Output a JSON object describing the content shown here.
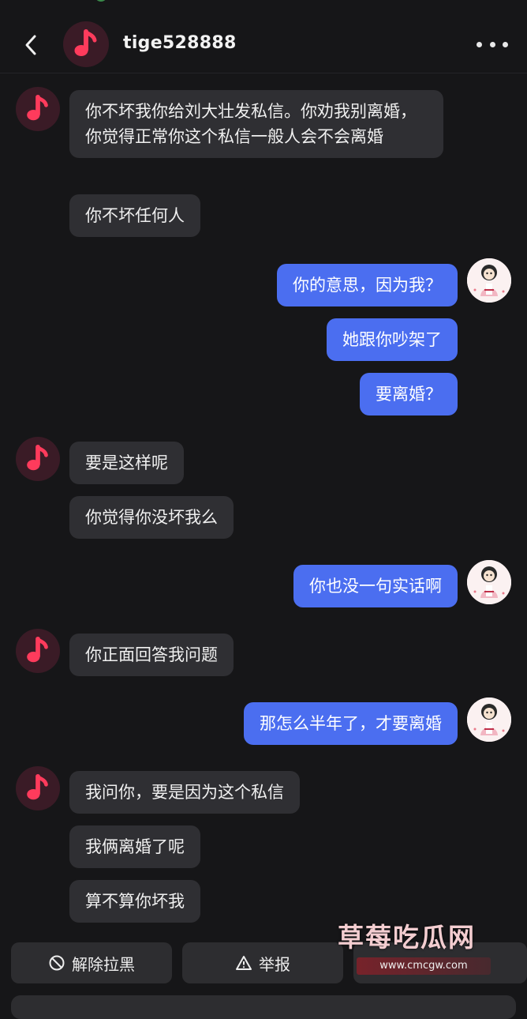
{
  "header": {
    "username": "tige528888"
  },
  "messages": [
    {
      "from": "other",
      "text": "你不坏我你给刘大壮发私信。你劝我别离婚，你觉得正常你这个私信一般人会不会离婚"
    },
    {
      "from": "other",
      "text": "你不坏任何人"
    },
    {
      "from": "me",
      "text": "你的意思，因为我？"
    },
    {
      "from": "me",
      "text": "她跟你吵架了"
    },
    {
      "from": "me",
      "text": "要离婚？"
    },
    {
      "from": "other",
      "text": "要是这样呢"
    },
    {
      "from": "other",
      "text": "你觉得你没坏我么"
    },
    {
      "from": "me",
      "text": "你也没一句实话啊"
    },
    {
      "from": "other",
      "text": "你正面回答我问题"
    },
    {
      "from": "me",
      "text": "那怎么半年了，才要离婚"
    },
    {
      "from": "other",
      "text": "我问你，要是因为这个私信"
    },
    {
      "from": "other",
      "text": "我俩离婚了呢"
    },
    {
      "from": "other",
      "text": "算不算你坏我"
    }
  ],
  "actions": {
    "unblock_label": "解除拉黑",
    "report_label": "举报"
  },
  "watermark": {
    "title": "草莓吃瓜网",
    "url": "www.cmcgw.com"
  },
  "colors": {
    "background": "#161618",
    "incoming_bubble": "#2f2f33",
    "outgoing_bubble": "#4b6ef0",
    "app_icon_accent": "#ff3b5c"
  },
  "icons": {
    "back": "chevron-left-icon",
    "app_avatar": "music-note-icon",
    "more": "more-dots-icon",
    "unblock": "block-circle-icon",
    "report": "warning-triangle-icon"
  }
}
